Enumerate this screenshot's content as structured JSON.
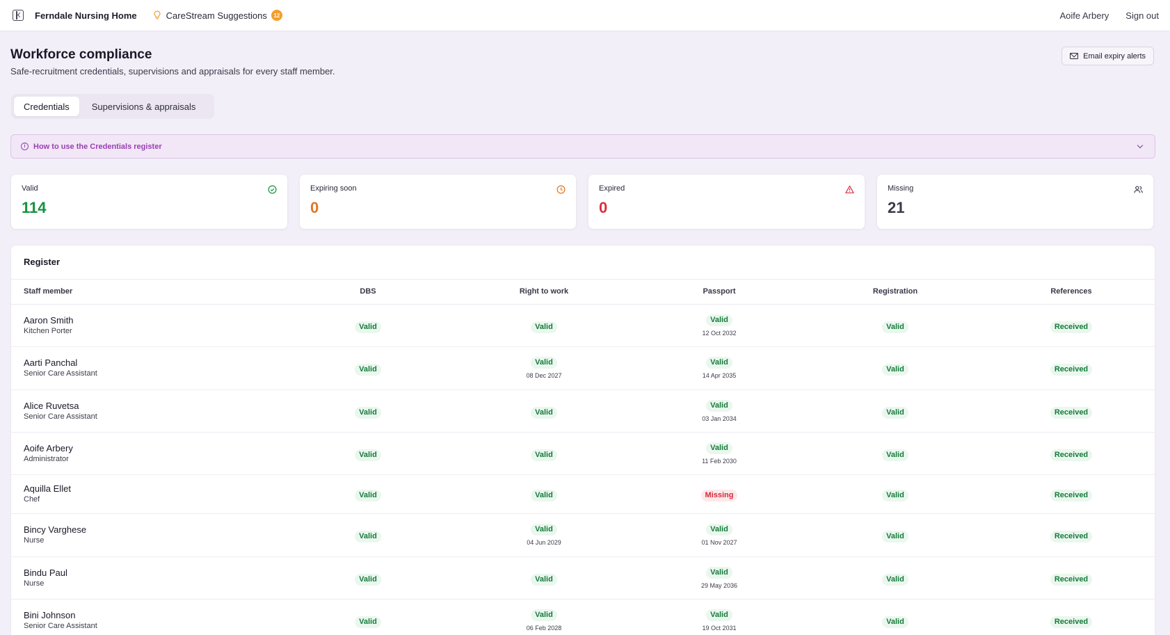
{
  "topbar": {
    "brand": "Ferndale Nursing Home",
    "suggestions_label": "CareStream Suggestions",
    "suggestions_count": "12",
    "user_name": "Aoife Arbery",
    "sign_out": "Sign out"
  },
  "header": {
    "title": "Workforce compliance",
    "subtitle": "Safe-recruitment credentials, supervisions and appraisals for every staff member.",
    "email_button": "Email expiry alerts"
  },
  "tabs": [
    {
      "label": "Credentials",
      "active": true
    },
    {
      "label": "Supervisions & appraisals",
      "active": false
    }
  ],
  "help_banner": {
    "text": "How to use the Credentials register"
  },
  "stats": [
    {
      "label": "Valid",
      "value": "114",
      "color": "#16913f",
      "icon": "check-circle-icon"
    },
    {
      "label": "Expiring soon",
      "value": "0",
      "color": "#e5751f",
      "icon": "clock-icon"
    },
    {
      "label": "Expired",
      "value": "0",
      "color": "#dc2f3e",
      "icon": "warning-triangle-icon"
    },
    {
      "label": "Missing",
      "value": "21",
      "color": "#3b3848",
      "icon": "users-icon"
    }
  ],
  "register": {
    "title": "Register",
    "columns": [
      "Staff member",
      "DBS",
      "Right to work",
      "Passport",
      "Registration",
      "References"
    ],
    "rows": [
      {
        "name": "Aaron Smith",
        "role": "Kitchen Porter",
        "dbs": {
          "status": "Valid",
          "date": ""
        },
        "rtw": {
          "status": "Valid",
          "date": ""
        },
        "passport": {
          "status": "Valid",
          "date": "12 Oct 2032"
        },
        "registration": {
          "status": "Valid",
          "date": ""
        },
        "references": {
          "status": "Received",
          "date": ""
        }
      },
      {
        "name": "Aarti Panchal",
        "role": "Senior Care Assistant",
        "dbs": {
          "status": "Valid",
          "date": ""
        },
        "rtw": {
          "status": "Valid",
          "date": "08 Dec 2027"
        },
        "passport": {
          "status": "Valid",
          "date": "14 Apr 2035"
        },
        "registration": {
          "status": "Valid",
          "date": ""
        },
        "references": {
          "status": "Received",
          "date": ""
        }
      },
      {
        "name": "Alice Ruvetsa",
        "role": "Senior Care Assistant",
        "dbs": {
          "status": "Valid",
          "date": ""
        },
        "rtw": {
          "status": "Valid",
          "date": ""
        },
        "passport": {
          "status": "Valid",
          "date": "03 Jan 2034"
        },
        "registration": {
          "status": "Valid",
          "date": ""
        },
        "references": {
          "status": "Received",
          "date": ""
        }
      },
      {
        "name": "Aoife Arbery",
        "role": "Administrator",
        "dbs": {
          "status": "Valid",
          "date": ""
        },
        "rtw": {
          "status": "Valid",
          "date": ""
        },
        "passport": {
          "status": "Valid",
          "date": "11 Feb 2030"
        },
        "registration": {
          "status": "Valid",
          "date": ""
        },
        "references": {
          "status": "Received",
          "date": ""
        }
      },
      {
        "name": "Aquilla Ellet",
        "role": "Chef",
        "dbs": {
          "status": "Valid",
          "date": ""
        },
        "rtw": {
          "status": "Valid",
          "date": ""
        },
        "passport": {
          "status": "Missing",
          "date": ""
        },
        "registration": {
          "status": "Valid",
          "date": ""
        },
        "references": {
          "status": "Received",
          "date": ""
        }
      },
      {
        "name": "Bincy Varghese",
        "role": "Nurse",
        "dbs": {
          "status": "Valid",
          "date": ""
        },
        "rtw": {
          "status": "Valid",
          "date": "04 Jun 2029"
        },
        "passport": {
          "status": "Valid",
          "date": "01 Nov 2027"
        },
        "registration": {
          "status": "Valid",
          "date": ""
        },
        "references": {
          "status": "Received",
          "date": ""
        }
      },
      {
        "name": "Bindu Paul",
        "role": "Nurse",
        "dbs": {
          "status": "Valid",
          "date": ""
        },
        "rtw": {
          "status": "Valid",
          "date": ""
        },
        "passport": {
          "status": "Valid",
          "date": "29 May 2036"
        },
        "registration": {
          "status": "Valid",
          "date": ""
        },
        "references": {
          "status": "Received",
          "date": ""
        }
      },
      {
        "name": "Bini Johnson",
        "role": "Senior Care Assistant",
        "dbs": {
          "status": "Valid",
          "date": ""
        },
        "rtw": {
          "status": "Valid",
          "date": "06 Feb 2028"
        },
        "passport": {
          "status": "Valid",
          "date": "19 Oct 2031"
        },
        "registration": {
          "status": "Valid",
          "date": ""
        },
        "references": {
          "status": "Received",
          "date": ""
        }
      }
    ]
  }
}
